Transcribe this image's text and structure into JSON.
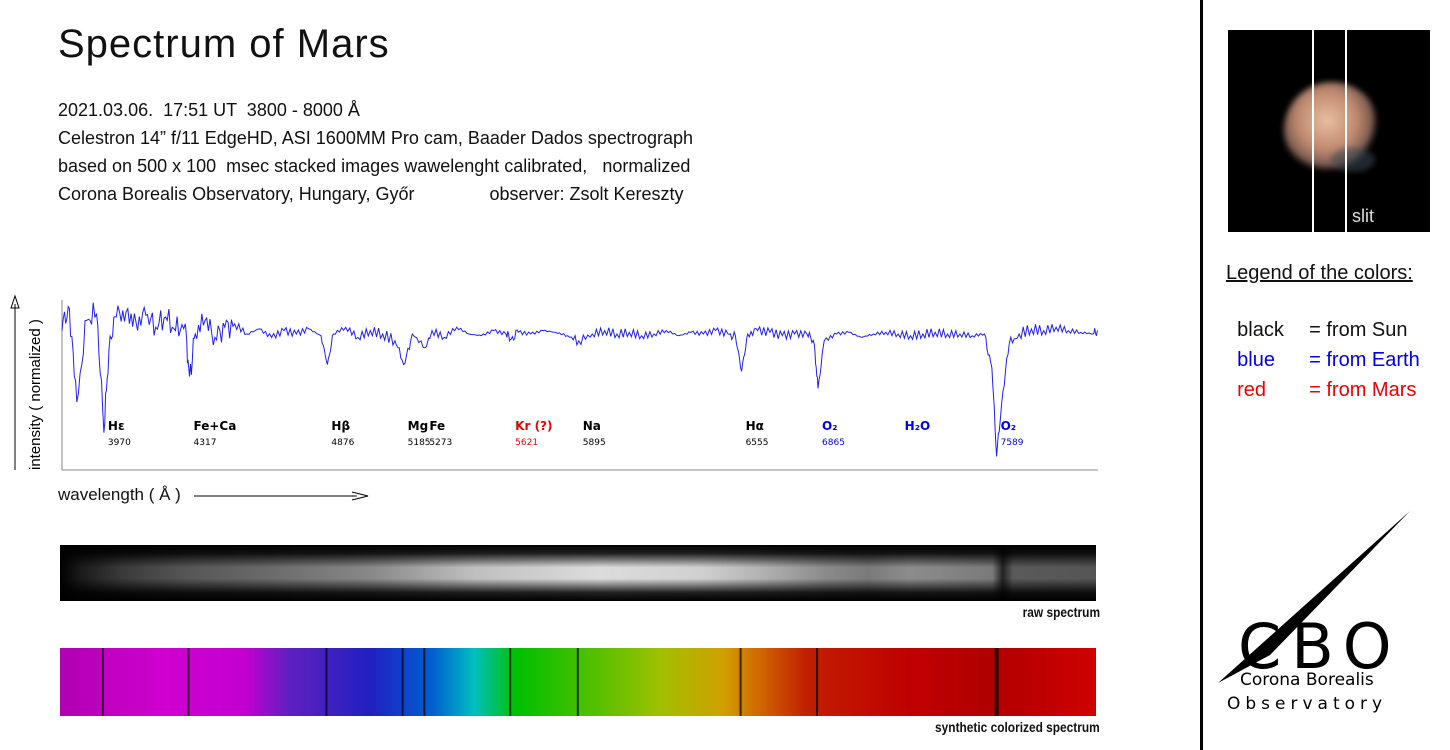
{
  "header": {
    "title": "Spectrum  of  Mars",
    "lines": [
      "2021.03.06.  17:51 UT  3800 - 8000 Å",
      "Celestron 14” f/11 EdgeHD, ASI 1600MM Pro cam, Baader Dados spectrograph",
      "based on 500 x 100  msec stacked images wawelenght calibrated,   normalized",
      "Corona Borealis Observatory, Hungary, Győr               observer: Zsolt Kereszty"
    ]
  },
  "axes": {
    "ylabel": "intensity ( normalized )",
    "xlabel": "wavelength  ( Å )"
  },
  "captions": {
    "raw": "raw spectrum",
    "synthetic": "synthetic colorized spectrum"
  },
  "image_label": "slit",
  "legend": {
    "title": "Legend of the colors:",
    "items": [
      {
        "key": "black",
        "value": "= from Sun",
        "color": "#000000"
      },
      {
        "key": "blue",
        "value": "= from Earth",
        "color": "#0000dd"
      },
      {
        "key": "red",
        "value": "= from Mars",
        "color": "#ee0000"
      }
    ]
  },
  "logo": {
    "letters": "CBO",
    "line1": "Corona Borealis",
    "line2": "Observatory"
  },
  "chart_data": {
    "type": "line",
    "title": "Spectrum  of  Mars",
    "xlabel": "wavelength  ( Å )",
    "ylabel": "intensity ( normalized )",
    "xlim": [
      3800,
      8000
    ],
    "ylim": [
      0,
      1
    ],
    "grid": false,
    "series_color": "#2020ee",
    "absorption_lines": [
      {
        "label": "Hε",
        "wavelength": "3970",
        "source": "Sun",
        "color": "#000000"
      },
      {
        "label": "Fe+Ca",
        "wavelength": "4317",
        "source": "Sun",
        "color": "#000000"
      },
      {
        "label": "Hβ",
        "wavelength": "4876",
        "source": "Sun",
        "color": "#000000"
      },
      {
        "label": "Mg",
        "wavelength": "5185",
        "source": "Sun",
        "color": "#000000"
      },
      {
        "label": "Fe",
        "wavelength": "5273",
        "source": "Sun",
        "color": "#000000"
      },
      {
        "label": "Kr (?)",
        "wavelength": "5621",
        "source": "Mars",
        "color": "#ee0000"
      },
      {
        "label": "Na",
        "wavelength": "5895",
        "source": "Sun",
        "color": "#000000"
      },
      {
        "label": "Hα",
        "wavelength": "6555",
        "source": "Sun",
        "color": "#000000"
      },
      {
        "label": "O₂",
        "wavelength": "6865",
        "source": "Earth",
        "color": "#0000dd"
      },
      {
        "label": "H₂O",
        "wavelength": "",
        "source": "Earth",
        "color": "#0000dd"
      },
      {
        "label": "O₂",
        "wavelength": "7589",
        "source": "Earth",
        "color": "#0000dd"
      }
    ],
    "series": [
      {
        "x": [
          3800,
          3830,
          3860,
          3900,
          3940,
          3970,
          3990,
          4020,
          4060,
          4100,
          4140,
          4180,
          4220,
          4260,
          4300,
          4317,
          4340,
          4380,
          4420,
          4460,
          4500,
          4550,
          4600,
          4650,
          4700,
          4750,
          4800,
          4850,
          4876,
          4900,
          4950,
          5000,
          5050,
          5100,
          5150,
          5185,
          5220,
          5273,
          5300,
          5350,
          5400,
          5450,
          5500,
          5550,
          5600,
          5621,
          5650,
          5700,
          5750,
          5800,
          5850,
          5895,
          5950,
          6000,
          6050,
          6100,
          6150,
          6200,
          6250,
          6300,
          6350,
          6400,
          6450,
          6500,
          6530,
          6555,
          6580,
          6620,
          6670,
          6720,
          6770,
          6820,
          6850,
          6865,
          6890,
          6940,
          6990,
          7040,
          7090,
          7140,
          7190,
          7240,
          7290,
          7340,
          7390,
          7440,
          7490,
          7540,
          7570,
          7589,
          7610,
          7640,
          7680,
          7730,
          7780,
          7830,
          7880,
          7930,
          7980,
          8000
        ],
        "y": [
          0.82,
          0.95,
          0.4,
          0.88,
          0.92,
          0.22,
          0.7,
          0.9,
          0.93,
          0.87,
          0.91,
          0.84,
          0.9,
          0.82,
          0.86,
          0.55,
          0.8,
          0.88,
          0.78,
          0.84,
          0.86,
          0.8,
          0.83,
          0.78,
          0.82,
          0.8,
          0.83,
          0.79,
          0.62,
          0.8,
          0.84,
          0.78,
          0.82,
          0.8,
          0.76,
          0.62,
          0.8,
          0.72,
          0.82,
          0.78,
          0.84,
          0.8,
          0.79,
          0.82,
          0.8,
          0.77,
          0.81,
          0.8,
          0.82,
          0.81,
          0.79,
          0.76,
          0.8,
          0.82,
          0.8,
          0.81,
          0.79,
          0.8,
          0.82,
          0.79,
          0.81,
          0.8,
          0.82,
          0.8,
          0.79,
          0.58,
          0.8,
          0.82,
          0.81,
          0.79,
          0.8,
          0.8,
          0.74,
          0.48,
          0.76,
          0.8,
          0.81,
          0.78,
          0.8,
          0.81,
          0.8,
          0.79,
          0.8,
          0.81,
          0.8,
          0.8,
          0.79,
          0.8,
          0.6,
          0.08,
          0.4,
          0.74,
          0.8,
          0.83,
          0.82,
          0.84,
          0.82,
          0.81,
          0.8,
          0.82
        ]
      }
    ]
  }
}
